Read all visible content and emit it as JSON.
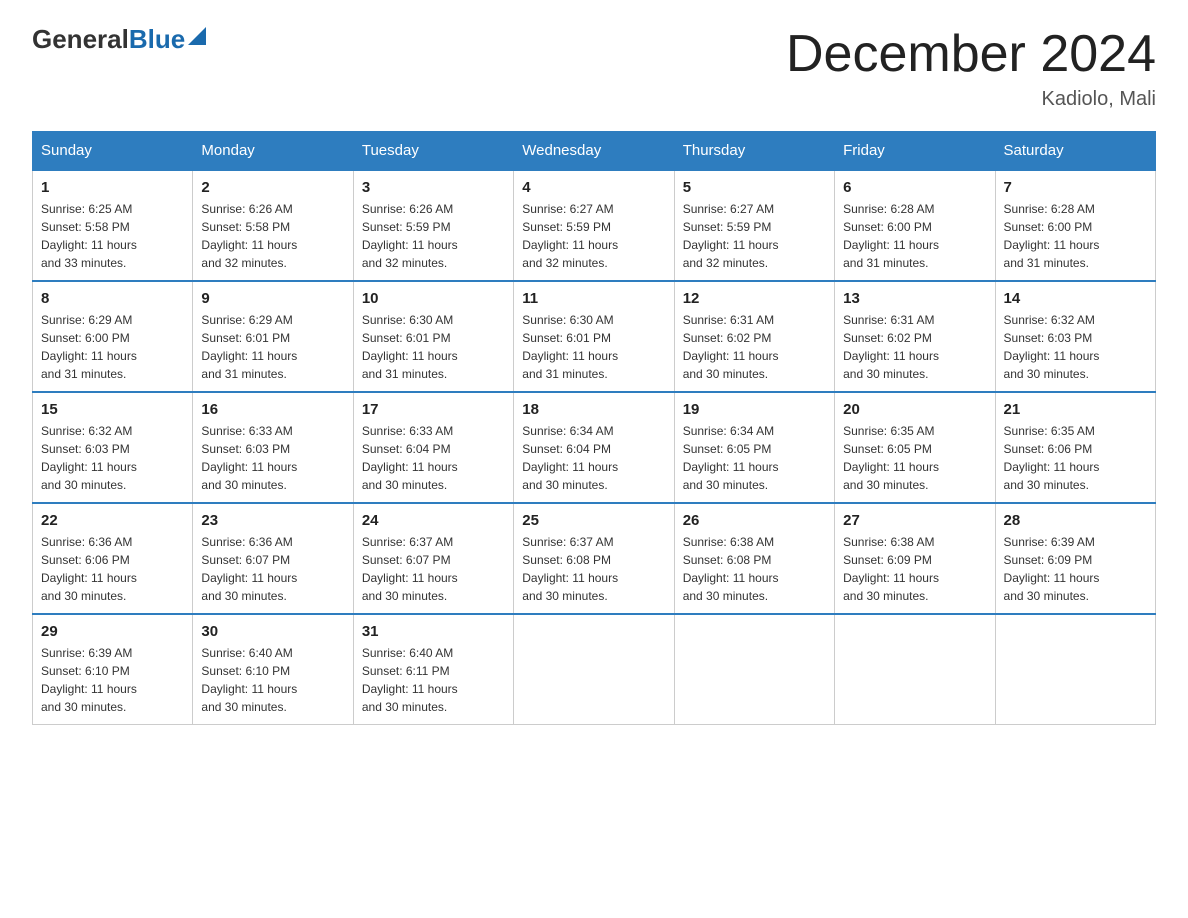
{
  "logo": {
    "general": "General",
    "blue": "Blue",
    "arrow": "▶"
  },
  "title": {
    "month_year": "December 2024",
    "location": "Kadiolo, Mali"
  },
  "days_of_week": [
    "Sunday",
    "Monday",
    "Tuesday",
    "Wednesday",
    "Thursday",
    "Friday",
    "Saturday"
  ],
  "weeks": [
    [
      {
        "day": "1",
        "sunrise": "6:25 AM",
        "sunset": "5:58 PM",
        "daylight": "11 hours and 33 minutes."
      },
      {
        "day": "2",
        "sunrise": "6:26 AM",
        "sunset": "5:58 PM",
        "daylight": "11 hours and 32 minutes."
      },
      {
        "day": "3",
        "sunrise": "6:26 AM",
        "sunset": "5:59 PM",
        "daylight": "11 hours and 32 minutes."
      },
      {
        "day": "4",
        "sunrise": "6:27 AM",
        "sunset": "5:59 PM",
        "daylight": "11 hours and 32 minutes."
      },
      {
        "day": "5",
        "sunrise": "6:27 AM",
        "sunset": "5:59 PM",
        "daylight": "11 hours and 32 minutes."
      },
      {
        "day": "6",
        "sunrise": "6:28 AM",
        "sunset": "6:00 PM",
        "daylight": "11 hours and 31 minutes."
      },
      {
        "day": "7",
        "sunrise": "6:28 AM",
        "sunset": "6:00 PM",
        "daylight": "11 hours and 31 minutes."
      }
    ],
    [
      {
        "day": "8",
        "sunrise": "6:29 AM",
        "sunset": "6:00 PM",
        "daylight": "11 hours and 31 minutes."
      },
      {
        "day": "9",
        "sunrise": "6:29 AM",
        "sunset": "6:01 PM",
        "daylight": "11 hours and 31 minutes."
      },
      {
        "day": "10",
        "sunrise": "6:30 AM",
        "sunset": "6:01 PM",
        "daylight": "11 hours and 31 minutes."
      },
      {
        "day": "11",
        "sunrise": "6:30 AM",
        "sunset": "6:01 PM",
        "daylight": "11 hours and 31 minutes."
      },
      {
        "day": "12",
        "sunrise": "6:31 AM",
        "sunset": "6:02 PM",
        "daylight": "11 hours and 30 minutes."
      },
      {
        "day": "13",
        "sunrise": "6:31 AM",
        "sunset": "6:02 PM",
        "daylight": "11 hours and 30 minutes."
      },
      {
        "day": "14",
        "sunrise": "6:32 AM",
        "sunset": "6:03 PM",
        "daylight": "11 hours and 30 minutes."
      }
    ],
    [
      {
        "day": "15",
        "sunrise": "6:32 AM",
        "sunset": "6:03 PM",
        "daylight": "11 hours and 30 minutes."
      },
      {
        "day": "16",
        "sunrise": "6:33 AM",
        "sunset": "6:03 PM",
        "daylight": "11 hours and 30 minutes."
      },
      {
        "day": "17",
        "sunrise": "6:33 AM",
        "sunset": "6:04 PM",
        "daylight": "11 hours and 30 minutes."
      },
      {
        "day": "18",
        "sunrise": "6:34 AM",
        "sunset": "6:04 PM",
        "daylight": "11 hours and 30 minutes."
      },
      {
        "day": "19",
        "sunrise": "6:34 AM",
        "sunset": "6:05 PM",
        "daylight": "11 hours and 30 minutes."
      },
      {
        "day": "20",
        "sunrise": "6:35 AM",
        "sunset": "6:05 PM",
        "daylight": "11 hours and 30 minutes."
      },
      {
        "day": "21",
        "sunrise": "6:35 AM",
        "sunset": "6:06 PM",
        "daylight": "11 hours and 30 minutes."
      }
    ],
    [
      {
        "day": "22",
        "sunrise": "6:36 AM",
        "sunset": "6:06 PM",
        "daylight": "11 hours and 30 minutes."
      },
      {
        "day": "23",
        "sunrise": "6:36 AM",
        "sunset": "6:07 PM",
        "daylight": "11 hours and 30 minutes."
      },
      {
        "day": "24",
        "sunrise": "6:37 AM",
        "sunset": "6:07 PM",
        "daylight": "11 hours and 30 minutes."
      },
      {
        "day": "25",
        "sunrise": "6:37 AM",
        "sunset": "6:08 PM",
        "daylight": "11 hours and 30 minutes."
      },
      {
        "day": "26",
        "sunrise": "6:38 AM",
        "sunset": "6:08 PM",
        "daylight": "11 hours and 30 minutes."
      },
      {
        "day": "27",
        "sunrise": "6:38 AM",
        "sunset": "6:09 PM",
        "daylight": "11 hours and 30 minutes."
      },
      {
        "day": "28",
        "sunrise": "6:39 AM",
        "sunset": "6:09 PM",
        "daylight": "11 hours and 30 minutes."
      }
    ],
    [
      {
        "day": "29",
        "sunrise": "6:39 AM",
        "sunset": "6:10 PM",
        "daylight": "11 hours and 30 minutes."
      },
      {
        "day": "30",
        "sunrise": "6:40 AM",
        "sunset": "6:10 PM",
        "daylight": "11 hours and 30 minutes."
      },
      {
        "day": "31",
        "sunrise": "6:40 AM",
        "sunset": "6:11 PM",
        "daylight": "11 hours and 30 minutes."
      },
      null,
      null,
      null,
      null
    ]
  ],
  "labels": {
    "sunrise": "Sunrise:",
    "sunset": "Sunset:",
    "daylight": "Daylight:"
  }
}
